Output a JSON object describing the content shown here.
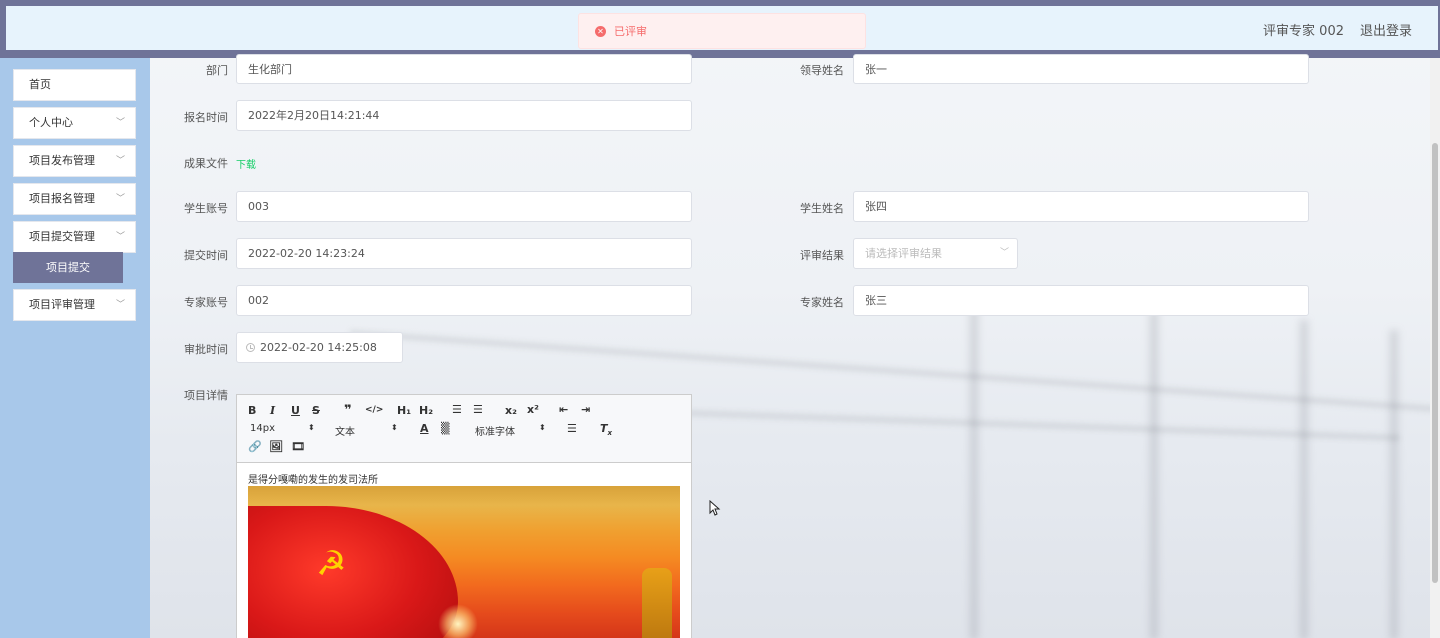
{
  "header": {
    "user_info": "评审专家 002",
    "logout": "退出登录",
    "toast": "已评审"
  },
  "sidebar": {
    "items": [
      {
        "label": "首页",
        "has_chevron": false
      },
      {
        "label": "个人中心",
        "has_chevron": true
      },
      {
        "label": "项目发布管理",
        "has_chevron": true
      },
      {
        "label": "项目报名管理",
        "has_chevron": true
      },
      {
        "label": "项目提交管理",
        "has_chevron": true
      },
      {
        "label": "项目评审管理",
        "has_chevron": true
      }
    ],
    "active_sub": "项目提交"
  },
  "form": {
    "department_label": "部门",
    "department_value": "生化部门",
    "leader_label": "领导姓名",
    "leader_value": "张一",
    "signup_time_label": "报名时间",
    "signup_time_value": "2022年2月20日14:21:44",
    "result_file_label": "成果文件",
    "result_file_link": "下载",
    "student_account_label": "学生账号",
    "student_account_value": "003",
    "student_name_label": "学生姓名",
    "student_name_value": "张四",
    "submit_time_label": "提交时间",
    "submit_time_value": "2022-02-20 14:23:24",
    "review_result_label": "评审结果",
    "review_result_placeholder": "请选择评审结果",
    "expert_account_label": "专家账号",
    "expert_account_value": "002",
    "expert_name_label": "专家姓名",
    "expert_name_value": "张三",
    "approve_time_label": "审批时间",
    "approve_time_value": "2022-02-20 14:25:08",
    "detail_label": "项目详情"
  },
  "editor": {
    "font_size": "14px",
    "text_type": "文本",
    "font_family": "标准字体",
    "content_text": "是得分嘎嘞的发生的发司法所"
  },
  "colors": {
    "header_bg": "#6f7398",
    "header_inner": "#e7f3fc",
    "sidebar_bg": "#a8c8ea",
    "active_sub_bg": "#6f7398",
    "toast_text": "#f56c6c",
    "link": "#13ce66"
  }
}
